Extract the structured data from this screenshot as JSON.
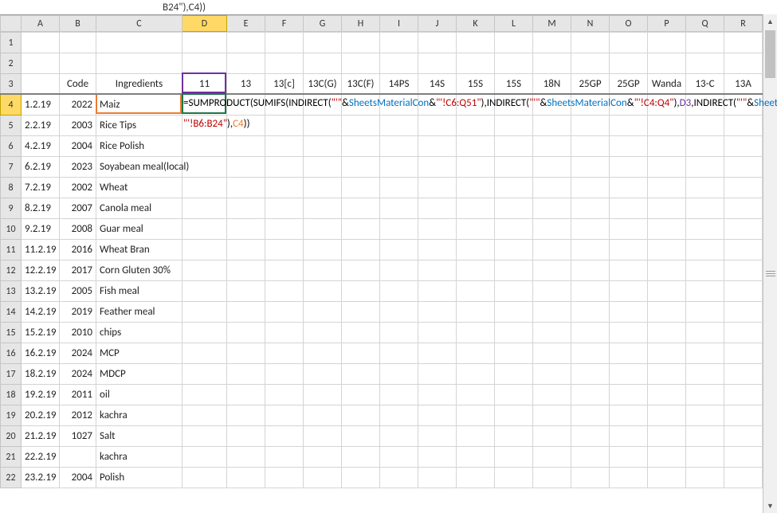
{
  "formula_bar_fragment": "B24\"),C4))",
  "columns": [
    "A",
    "B",
    "C",
    "D",
    "E",
    "F",
    "G",
    "H",
    "I",
    "J",
    "K",
    "L",
    "M",
    "N",
    "O",
    "P",
    "Q",
    "R"
  ],
  "active_col_index": 3,
  "row_headers": [
    1,
    2,
    3,
    4,
    5,
    6,
    7,
    8,
    9,
    10,
    11,
    12,
    13,
    14,
    15,
    16,
    17,
    18,
    19,
    20,
    21,
    22
  ],
  "active_row_index": 3,
  "header_labels": {
    "B": "Code",
    "C": "Ingredients",
    "D": "11",
    "E": "13",
    "F": "13[c]",
    "G": "13C(G)",
    "H": "13C(F)",
    "I": "14PS",
    "J": "14S",
    "K": "15S",
    "L": "15S",
    "M": "18N",
    "N": "25GP",
    "O": "25GP",
    "P": "Wanda",
    "Q": "13-C",
    "R": "13A"
  },
  "data_rows": [
    {
      "A": "1.2.19",
      "B": "2022",
      "C": "Maiz"
    },
    {
      "A": "2.2.19",
      "B": "2003",
      "C": "Rice Tips"
    },
    {
      "A": "4.2.19",
      "B": "2004",
      "C": "Rice Polish"
    },
    {
      "A": "6.2.19",
      "B": "2023",
      "C": "Soyabean meal(local)"
    },
    {
      "A": "7.2.19",
      "B": "2002",
      "C": "Wheat"
    },
    {
      "A": "8.2.19",
      "B": "2007",
      "C": "Canola meal"
    },
    {
      "A": "9.2.19",
      "B": "2008",
      "C": "Guar meal"
    },
    {
      "A": "11.2.19",
      "B": "2016",
      "C": "Wheat Bran"
    },
    {
      "A": "12.2.19",
      "B": "2017",
      "C": "Corn Gluten 30%"
    },
    {
      "A": "13.2.19",
      "B": "2005",
      "C": "Fish meal"
    },
    {
      "A": "14.2.19",
      "B": "2019",
      "C": "Feather meal"
    },
    {
      "A": "15.2.19",
      "B": "2010",
      "C": "chips"
    },
    {
      "A": "16.2.19",
      "B": "2024",
      "C": "MCP"
    },
    {
      "A": "18.2.19",
      "B": "2024",
      "C": "MDCP"
    },
    {
      "A": "19.2.19",
      "B": "2011",
      "C": "oil"
    },
    {
      "A": "20.2.19",
      "B": "2012",
      "C": "kachra"
    },
    {
      "A": "21.2.19",
      "B": "1027",
      "C": "Salt"
    },
    {
      "A": "22.2.19",
      "B": "",
      "C": "kachra"
    },
    {
      "A": "23.2.19",
      "B": "2004",
      "C": "Polish"
    }
  ],
  "formula_edit": {
    "line1_parts": [
      {
        "t": "=SUMPRODUCT(",
        "cls": "fx-black"
      },
      {
        "t": "SUMIFS(",
        "cls": "fx-black"
      },
      {
        "t": "INDIRECT(",
        "cls": "fx-black"
      },
      {
        "t": "\"'\"",
        "cls": "fx-red"
      },
      {
        "t": "&",
        "cls": "fx-black"
      },
      {
        "t": "SheetsMaterialCon",
        "cls": "fx-blue"
      },
      {
        "t": "&",
        "cls": "fx-black"
      },
      {
        "t": "\"'!C6:Q51\"",
        "cls": "fx-red"
      },
      {
        "t": "),",
        "cls": "fx-black"
      },
      {
        "t": "INDIRECT(",
        "cls": "fx-black"
      },
      {
        "t": "\"'\"",
        "cls": "fx-red"
      },
      {
        "t": "&",
        "cls": "fx-black"
      },
      {
        "t": "SheetsMaterialCon",
        "cls": "fx-blue"
      },
      {
        "t": "&",
        "cls": "fx-black"
      },
      {
        "t": "\"'!C4:Q4\"",
        "cls": "fx-red"
      },
      {
        "t": "),",
        "cls": "fx-black"
      },
      {
        "t": "D3",
        "cls": "fx-purple"
      },
      {
        "t": ",",
        "cls": "fx-black"
      },
      {
        "t": "INDIRECT(",
        "cls": "fx-black"
      },
      {
        "t": "\"'\"",
        "cls": "fx-red"
      },
      {
        "t": "&",
        "cls": "fx-black"
      },
      {
        "t": "SheetsMaterialCon",
        "cls": "fx-blue"
      },
      {
        "t": "&",
        "cls": "fx-black"
      }
    ],
    "line2_parts": [
      {
        "t": "\"'!B6:B24\"",
        "cls": "fx-red"
      },
      {
        "t": "),",
        "cls": "fx-black"
      },
      {
        "t": "C4",
        "cls": "fx-orange"
      },
      {
        "t": "))",
        "cls": "fx-black"
      }
    ]
  }
}
